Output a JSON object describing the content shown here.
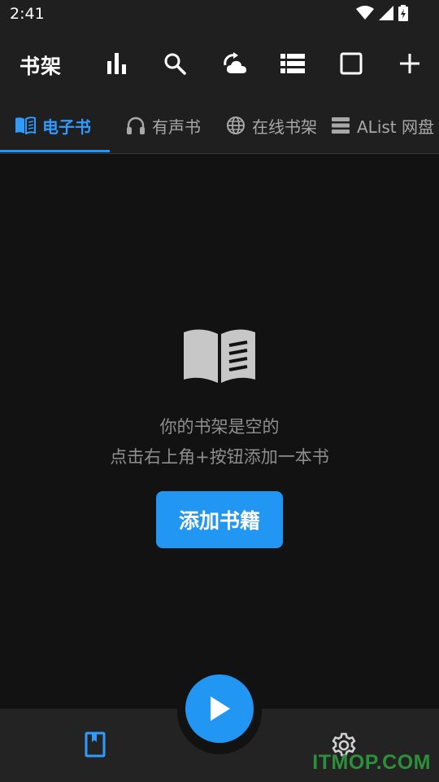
{
  "status": {
    "time": "2:41"
  },
  "appbar": {
    "title": "书架",
    "actions": [
      "bar-chart-icon",
      "search-icon",
      "sync-cloud-icon",
      "list-view-icon",
      "select-square-icon",
      "add-icon"
    ]
  },
  "tabs": [
    {
      "label": "电子书",
      "icon": "book-open-icon",
      "active": true
    },
    {
      "label": "有声书",
      "icon": "headphones-icon",
      "active": false
    },
    {
      "label": "在线书架",
      "icon": "globe-icon",
      "active": false
    },
    {
      "label": "AList 网盘",
      "icon": "server-icon",
      "active": false
    }
  ],
  "empty": {
    "line1": "你的书架是空的",
    "line2": "点击右上角+按钮添加一本书",
    "button": "添加书籍"
  },
  "bottom_nav": {
    "items": [
      "bookshelf-icon",
      "play-icon",
      "settings-icon"
    ]
  },
  "watermark": "ITMOP.COM",
  "colors": {
    "accent": "#2196f3",
    "background": "#121212",
    "bar": "#1f1f1f"
  }
}
